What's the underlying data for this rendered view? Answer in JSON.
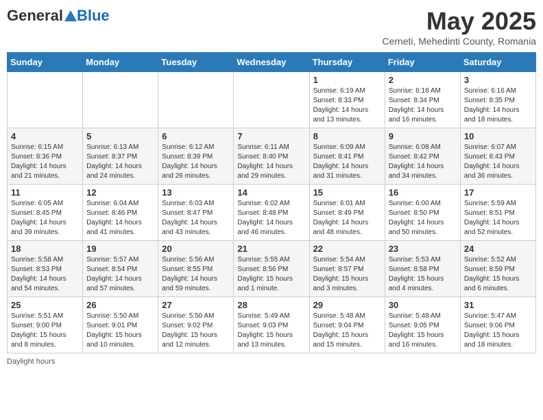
{
  "header": {
    "logo_general": "General",
    "logo_blue": "Blue",
    "month_title": "May 2025",
    "location": "Cerneti, Mehedinti County, Romania"
  },
  "weekdays": [
    "Sunday",
    "Monday",
    "Tuesday",
    "Wednesday",
    "Thursday",
    "Friday",
    "Saturday"
  ],
  "weeks": [
    [
      {
        "day": "",
        "info": ""
      },
      {
        "day": "",
        "info": ""
      },
      {
        "day": "",
        "info": ""
      },
      {
        "day": "",
        "info": ""
      },
      {
        "day": "1",
        "info": "Sunrise: 6:19 AM\nSunset: 8:33 PM\nDaylight: 14 hours and 13 minutes."
      },
      {
        "day": "2",
        "info": "Sunrise: 6:18 AM\nSunset: 8:34 PM\nDaylight: 14 hours and 16 minutes."
      },
      {
        "day": "3",
        "info": "Sunrise: 6:16 AM\nSunset: 8:35 PM\nDaylight: 14 hours and 18 minutes."
      }
    ],
    [
      {
        "day": "4",
        "info": "Sunrise: 6:15 AM\nSunset: 8:36 PM\nDaylight: 14 hours and 21 minutes."
      },
      {
        "day": "5",
        "info": "Sunrise: 6:13 AM\nSunset: 8:37 PM\nDaylight: 14 hours and 24 minutes."
      },
      {
        "day": "6",
        "info": "Sunrise: 6:12 AM\nSunset: 8:39 PM\nDaylight: 14 hours and 26 minutes."
      },
      {
        "day": "7",
        "info": "Sunrise: 6:11 AM\nSunset: 8:40 PM\nDaylight: 14 hours and 29 minutes."
      },
      {
        "day": "8",
        "info": "Sunrise: 6:09 AM\nSunset: 8:41 PM\nDaylight: 14 hours and 31 minutes."
      },
      {
        "day": "9",
        "info": "Sunrise: 6:08 AM\nSunset: 8:42 PM\nDaylight: 14 hours and 34 minutes."
      },
      {
        "day": "10",
        "info": "Sunrise: 6:07 AM\nSunset: 8:43 PM\nDaylight: 14 hours and 36 minutes."
      }
    ],
    [
      {
        "day": "11",
        "info": "Sunrise: 6:05 AM\nSunset: 8:45 PM\nDaylight: 14 hours and 39 minutes."
      },
      {
        "day": "12",
        "info": "Sunrise: 6:04 AM\nSunset: 8:46 PM\nDaylight: 14 hours and 41 minutes."
      },
      {
        "day": "13",
        "info": "Sunrise: 6:03 AM\nSunset: 8:47 PM\nDaylight: 14 hours and 43 minutes."
      },
      {
        "day": "14",
        "info": "Sunrise: 6:02 AM\nSunset: 8:48 PM\nDaylight: 14 hours and 46 minutes."
      },
      {
        "day": "15",
        "info": "Sunrise: 6:01 AM\nSunset: 8:49 PM\nDaylight: 14 hours and 48 minutes."
      },
      {
        "day": "16",
        "info": "Sunrise: 6:00 AM\nSunset: 8:50 PM\nDaylight: 14 hours and 50 minutes."
      },
      {
        "day": "17",
        "info": "Sunrise: 5:59 AM\nSunset: 8:51 PM\nDaylight: 14 hours and 52 minutes."
      }
    ],
    [
      {
        "day": "18",
        "info": "Sunrise: 5:58 AM\nSunset: 8:53 PM\nDaylight: 14 hours and 54 minutes."
      },
      {
        "day": "19",
        "info": "Sunrise: 5:57 AM\nSunset: 8:54 PM\nDaylight: 14 hours and 57 minutes."
      },
      {
        "day": "20",
        "info": "Sunrise: 5:56 AM\nSunset: 8:55 PM\nDaylight: 14 hours and 59 minutes."
      },
      {
        "day": "21",
        "info": "Sunrise: 5:55 AM\nSunset: 8:56 PM\nDaylight: 15 hours and 1 minute."
      },
      {
        "day": "22",
        "info": "Sunrise: 5:54 AM\nSunset: 8:57 PM\nDaylight: 15 hours and 3 minutes."
      },
      {
        "day": "23",
        "info": "Sunrise: 5:53 AM\nSunset: 8:58 PM\nDaylight: 15 hours and 4 minutes."
      },
      {
        "day": "24",
        "info": "Sunrise: 5:52 AM\nSunset: 8:59 PM\nDaylight: 15 hours and 6 minutes."
      }
    ],
    [
      {
        "day": "25",
        "info": "Sunrise: 5:51 AM\nSunset: 9:00 PM\nDaylight: 15 hours and 8 minutes."
      },
      {
        "day": "26",
        "info": "Sunrise: 5:50 AM\nSunset: 9:01 PM\nDaylight: 15 hours and 10 minutes."
      },
      {
        "day": "27",
        "info": "Sunrise: 5:50 AM\nSunset: 9:02 PM\nDaylight: 15 hours and 12 minutes."
      },
      {
        "day": "28",
        "info": "Sunrise: 5:49 AM\nSunset: 9:03 PM\nDaylight: 15 hours and 13 minutes."
      },
      {
        "day": "29",
        "info": "Sunrise: 5:48 AM\nSunset: 9:04 PM\nDaylight: 15 hours and 15 minutes."
      },
      {
        "day": "30",
        "info": "Sunrise: 5:48 AM\nSunset: 9:05 PM\nDaylight: 15 hours and 16 minutes."
      },
      {
        "day": "31",
        "info": "Sunrise: 5:47 AM\nSunset: 9:06 PM\nDaylight: 15 hours and 18 minutes."
      }
    ]
  ],
  "footer": {
    "daylight_label": "Daylight hours"
  }
}
